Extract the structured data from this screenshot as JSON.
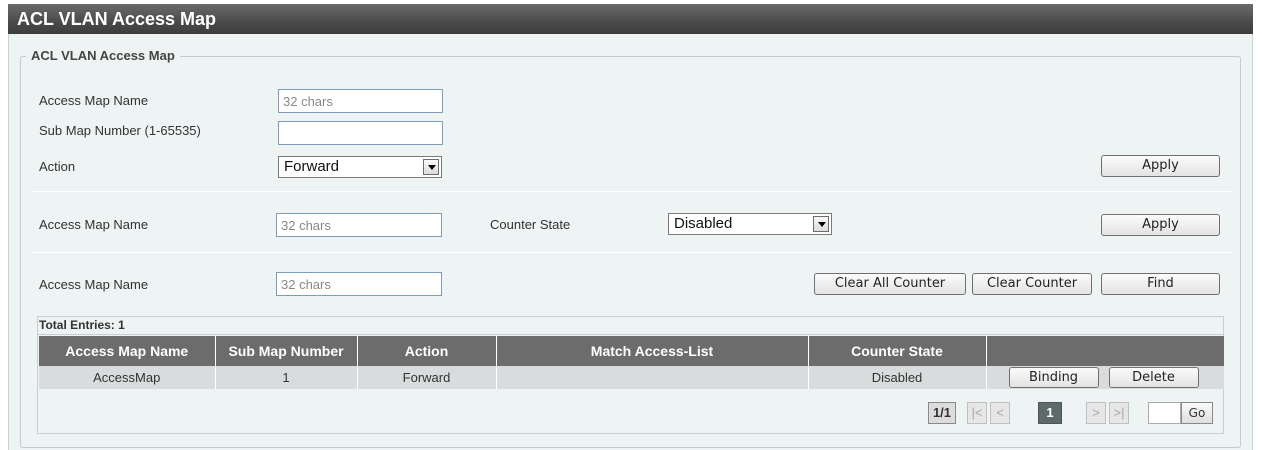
{
  "title": "ACL VLAN Access Map",
  "fieldset_legend": "ACL VLAN Access Map",
  "section1": {
    "access_map_name_label": "Access Map Name",
    "access_map_name_placeholder": "32 chars",
    "sub_map_label": "Sub Map Number (1-65535)",
    "sub_map_value": "",
    "action_label": "Action",
    "action_selected": "Forward",
    "apply_label": "Apply"
  },
  "section2": {
    "access_map_name_label": "Access Map Name",
    "access_map_name_placeholder": "32 chars",
    "counter_state_label": "Counter State",
    "counter_state_selected": "Disabled",
    "apply_label": "Apply"
  },
  "section3": {
    "access_map_name_label": "Access Map Name",
    "access_map_name_placeholder": "32 chars",
    "clear_all_label": "Clear All Counter",
    "clear_label": "Clear Counter",
    "find_label": "Find"
  },
  "table": {
    "total_entries": "Total Entries: 1",
    "headers": [
      "Access Map Name",
      "Sub Map Number",
      "Action",
      "Match Access-List",
      "Counter State",
      ""
    ],
    "rows": [
      {
        "name": "AccessMap",
        "sub_map": "1",
        "action": "Forward",
        "match": "",
        "counter_state": "Disabled",
        "binding": "Binding",
        "delete": "Delete"
      }
    ]
  },
  "pager": {
    "page_indicator": "1/1",
    "first": "|<",
    "prev": "<",
    "current": "1",
    "next": ">",
    "last": ">|",
    "go_label": "Go",
    "go_value": ""
  },
  "colors": {
    "header_bg": "#4a4a4a",
    "panel_bg": "#eef3f3",
    "table_header_bg": "#6c6c6c",
    "row_bg": "#d9dcdc"
  }
}
